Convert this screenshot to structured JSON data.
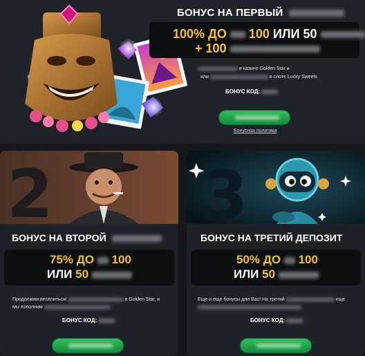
{
  "colors": {
    "accent_yellow": "#f5c518",
    "button_green": "#1fa84a",
    "card_bg": "#1e2127",
    "offer_bg": "#0d0e10"
  },
  "hero": {
    "title": "БОНУС НА ПЕРВЫЙ",
    "offer_prefix": "100% ДО",
    "offer_amount": "100",
    "offer_or": "ИЛИ 50",
    "offer_line2": "+ 100",
    "desc_line1": "в казино Golden Star и",
    "desc_line2_prefix": "или",
    "desc_line2_suffix": "в слоте Lucky Sweets",
    "code_label": "БОНУС КОД:",
    "policy_link": "Бонусная политика",
    "art_icon": "tiki-mask-icon"
  },
  "card2": {
    "title": "БОНУС НА ВТОРОЙ",
    "offer_line1_pct": "75% ДО",
    "offer_line1_amount": "100",
    "offer_line2_or": "ИЛИ",
    "offer_line2_amount": "50",
    "desc_line1_prefix": "Продолжим веселиться!",
    "desc_line1_suffix": "в Golden Star, и",
    "desc_line2": "мы пополним",
    "code_label": "БОНУС КОД:",
    "art_number": "2",
    "art_icon": "gangster-character-icon"
  },
  "card3": {
    "title": "БОНУС НА ТРЕТИЙ ДЕПОЗИТ",
    "offer_line1_pct": "50% ДО",
    "offer_line1_amount": "100",
    "offer_line2_or": "ИЛИ",
    "offer_line2_amount": "50",
    "desc_line1_prefix": "Еще и еще бонусы для Вас! На третий",
    "desc_line1_suffix": "еще",
    "code_label": "БОНУС КОД:",
    "art_number": "3",
    "art_icon": "robot-character-icon"
  }
}
